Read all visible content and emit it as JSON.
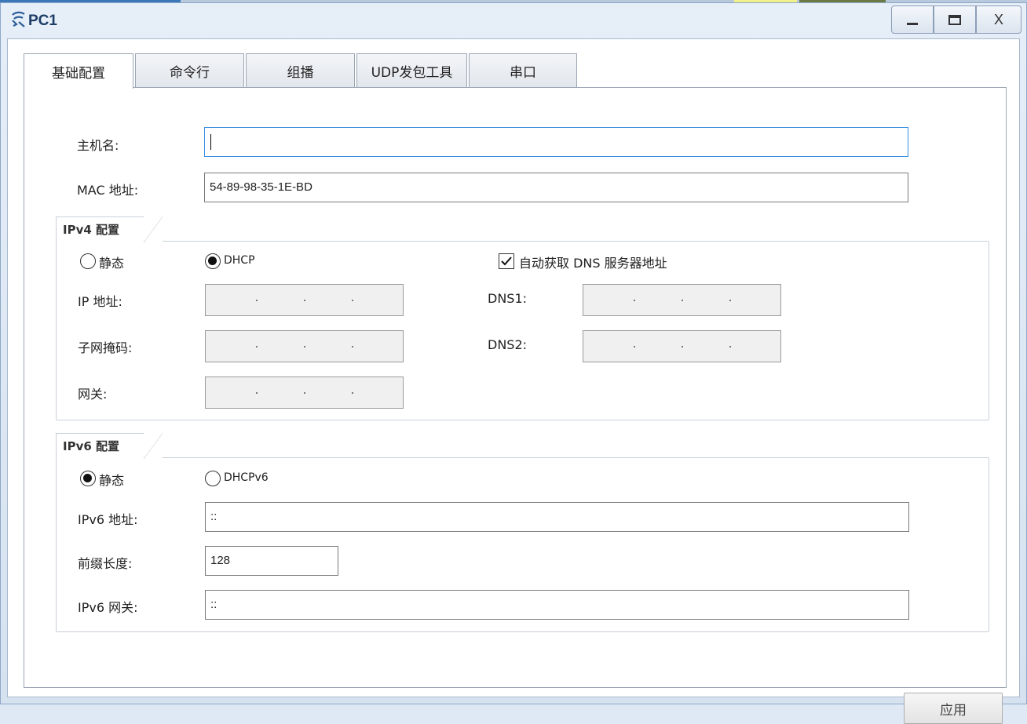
{
  "window": {
    "title": "PC1",
    "close_label": "X"
  },
  "tabs": [
    {
      "label": "基础配置",
      "active": true
    },
    {
      "label": "命令行",
      "active": false
    },
    {
      "label": "组播",
      "active": false
    },
    {
      "label": "UDP发包工具",
      "active": false
    },
    {
      "label": "串口",
      "active": false
    }
  ],
  "basic": {
    "hostname_label": "主机名:",
    "hostname_value": "",
    "mac_label": "MAC 地址:",
    "mac_value": "54-89-98-35-1E-BD"
  },
  "ipv4": {
    "group_title": "IPv4 配置",
    "static_label": "静态",
    "static_selected": false,
    "dhcp_label": "DHCP",
    "dhcp_selected": true,
    "auto_dns_label": "自动获取 DNS 服务器地址",
    "auto_dns_checked": true,
    "ip_label": "IP 地址:",
    "mask_label": "子网掩码:",
    "gateway_label": "网关:",
    "dns1_label": "DNS1:",
    "dns2_label": "DNS2:"
  },
  "ipv6": {
    "group_title": "IPv6 配置",
    "static_label": "静态",
    "static_selected": true,
    "dhcpv6_label": "DHCPv6",
    "dhcpv6_selected": false,
    "address_label": "IPv6 地址:",
    "address_value": "::",
    "prefix_label": "前缀长度:",
    "prefix_value": "128",
    "gateway_label": "IPv6 网关:",
    "gateway_value": "::"
  },
  "apply_label": "应用",
  "icons": [
    "network-pc-icon",
    "minimize-icon",
    "maximize-icon",
    "close-icon",
    "radio-icon",
    "checkbox-icon"
  ]
}
